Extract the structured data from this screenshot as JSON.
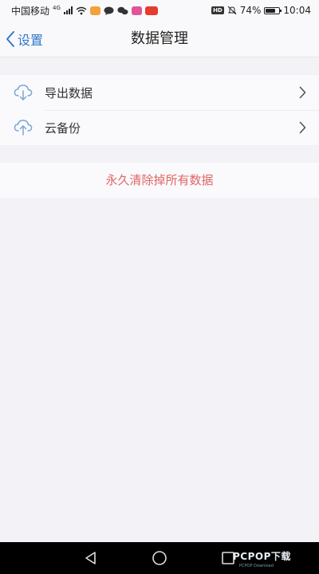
{
  "status_bar": {
    "carrier": "中国移动",
    "network": "4G",
    "battery_percent": "74%",
    "battery_level": 0.74,
    "time": "10:04",
    "hd_badge": "HD",
    "icons": [
      "signal-icon",
      "wifi-icon",
      "mail-app-icon",
      "chat-bubble-icon",
      "wechat-icon",
      "app-icon-pink",
      "app-icon-red",
      "mute-icon",
      "battery-icon"
    ]
  },
  "nav": {
    "back_label": "设置",
    "title": "数据管理"
  },
  "menu": {
    "items": [
      {
        "label": "导出数据",
        "icon": "cloud-download-icon"
      },
      {
        "label": "云备份",
        "icon": "cloud-upload-icon"
      }
    ]
  },
  "danger": {
    "clear_label": "永久清除掉所有数据"
  },
  "colors": {
    "accent": "#3478c9",
    "danger": "#e06565",
    "background": "#f2f2f7",
    "icon": "#7aa6d6"
  },
  "watermark": {
    "text": "PCPOP下载",
    "sub": "PCPOP Download"
  }
}
